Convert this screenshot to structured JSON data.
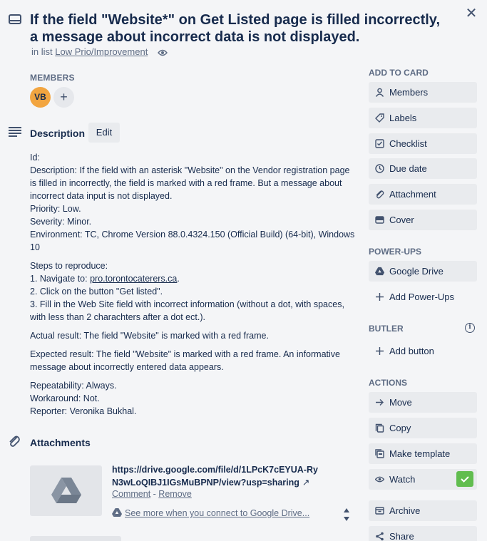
{
  "card": {
    "title": "If the field \"Website*\" on Get Listed page is filled incorrectly, a message about incorrect data is not displayed.",
    "in_list_prefix": "in list",
    "list_name": "Low Prio/Improvement"
  },
  "members": {
    "label": "MEMBERS",
    "avatar_initials": "VB",
    "add_symbol": "+"
  },
  "description": {
    "title": "Description",
    "edit_label": "Edit",
    "lines": {
      "id": "Id:",
      "desc": "Description: If the field with an asterisk \"Website\" on the Vendor registration page is filled in incorrectly, the field is marked with a red frame. But a message about incorrect data input is not displayed.",
      "priority": "Priority: Low.",
      "severity": "Severity: Minor.",
      "environment": "Environment: TC, Chrome Version 88.0.4324.150 (Official Build) (64-bit), Windows 10",
      "steps_header": "Steps to reproduce:",
      "step1_prefix": "1. Navigate to: ",
      "step1_link": "pro.torontocaterers.ca",
      "step1_suffix": ".",
      "step2": "2. Click on the button \"Get listed\".",
      "step3": "3. Fill in the Web Site field with incorrect information (without a dot, with spaces, with less than 2 charachters after a dot ect.).",
      "actual": "Actual result: The field \"Website\" is marked with a red frame.",
      "expected": "Expected result: The field \"Website\" is marked with a red frame. An informative message about incorrectly entered data appears.",
      "repeatability": "Repeatability: Always.",
      "workaround": "Workaround: Not.",
      "reporter": "Reporter: Veronika Bukhal."
    }
  },
  "attachments": {
    "title": "Attachments",
    "link": "https://drive.google.com/file/d/1LPcK7cEYUA-RyN3wLoQIBJ1IGsMuBPNP/view?usp=sharing",
    "external_symbol": "↗",
    "comment_label": "Comment",
    "separator": " - ",
    "remove_label": "Remove",
    "drive_prompt": "See more when you connect to Google Drive..."
  },
  "sidebar": {
    "add_to_card_label": "ADD TO CARD",
    "add_to_card": [
      "Members",
      "Labels",
      "Checklist",
      "Due date",
      "Attachment",
      "Cover"
    ],
    "power_ups_label": "POWER-UPS",
    "power_ups": [
      "Google Drive",
      "Add Power-Ups"
    ],
    "butler_label": "BUTLER",
    "butler_info": "i",
    "butler": [
      "Add button"
    ],
    "actions_label": "ACTIONS",
    "actions": [
      "Move",
      "Copy",
      "Make template",
      "Watch",
      "Archive",
      "Share"
    ]
  },
  "colors": {
    "background": "#f4f5f7",
    "button": "#e9ebee",
    "text": "#172b4d",
    "muted": "#5e6c84",
    "avatar": "#f2a540",
    "watch_check": "#61bd4f"
  }
}
